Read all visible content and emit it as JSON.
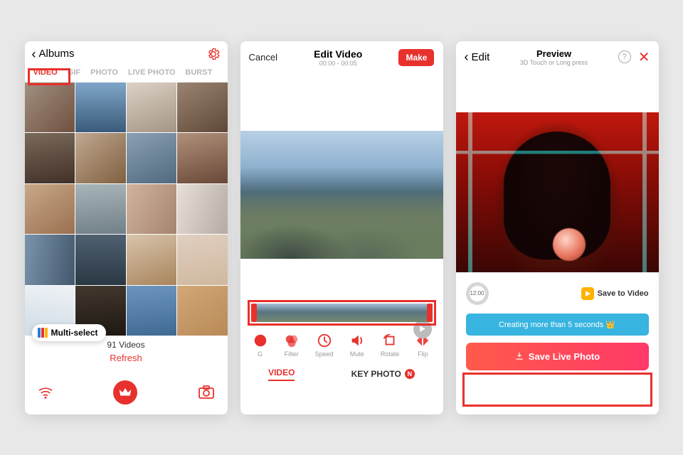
{
  "screen1": {
    "back_label": "Albums",
    "tabs": [
      "VIDEO",
      "GIF",
      "PHOTO",
      "LIVE PHOTO",
      "BURST"
    ],
    "active_tab": "VIDEO",
    "multi_select_label": "Multi-select",
    "video_count_label": "91 Videos",
    "refresh_label": "Refresh"
  },
  "screen2": {
    "cancel_label": "Cancel",
    "title": "Edit Video",
    "time_range": "00:00 - 00:05",
    "make_label": "Make",
    "tools": {
      "bg": "G",
      "filter": "Filter",
      "speed": "Speed",
      "mute": "Mute",
      "rotate": "Rotate",
      "flip": "Flip"
    },
    "tab_video": "VIDEO",
    "tab_keyphoto": "KEY PHOTO",
    "badge": "N"
  },
  "screen3": {
    "back_label": "Edit",
    "title": "Preview",
    "subtitle": "3D Touch or Long press",
    "time_chip": "12:00",
    "save_video_label": "Save to Video",
    "banner": "Creating more than 5 seconds 👑",
    "save_live_label": "Save Live Photo"
  }
}
